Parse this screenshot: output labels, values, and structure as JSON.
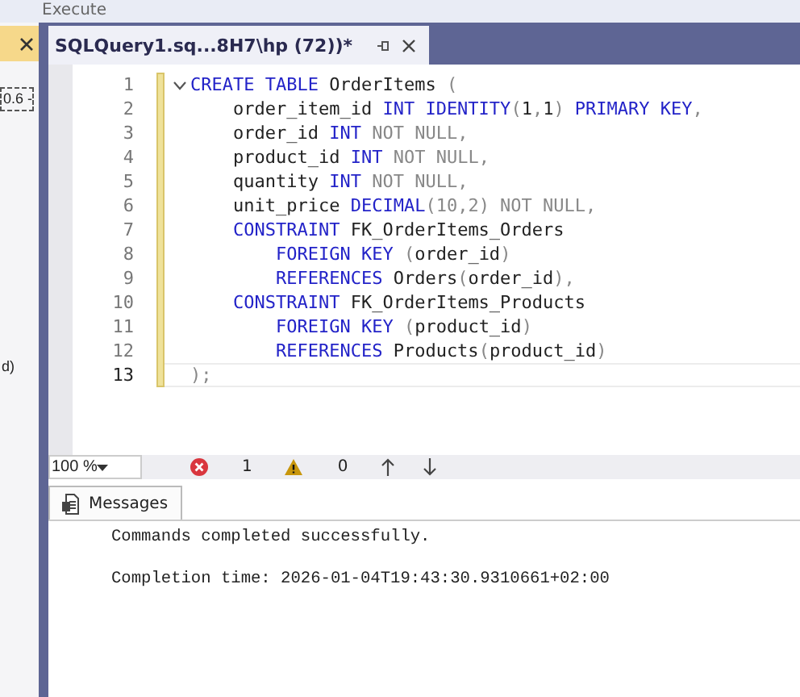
{
  "toolbar": {
    "execute_label": "Execute"
  },
  "left_panel": {
    "items": [
      {
        "label": "0.6 -",
        "selected": true
      },
      {
        "label": "d)",
        "selected": false
      }
    ]
  },
  "document_tab": {
    "title": "SQLQuery1.sq...8H7\\hp (72))*",
    "selected": true
  },
  "editor": {
    "lines": [
      {
        "number": "1",
        "current": false,
        "expanded": true,
        "tokens": [
          {
            "kind": "keyword",
            "text": "CREATE TABLE"
          },
          {
            "kind": "plain",
            "text": " OrderItems "
          },
          {
            "kind": "punct",
            "text": "("
          }
        ],
        "children": [
          {
            "number": "2",
            "current": false,
            "tokens": [
              {
                "kind": "plain",
                "text": "order_item_id "
              },
              {
                "kind": "keyword",
                "text": "INT IDENTITY"
              },
              {
                "kind": "punct",
                "text": "("
              },
              {
                "kind": "plain",
                "text": "1"
              },
              {
                "kind": "punct",
                "text": ","
              },
              {
                "kind": "plain",
                "text": "1"
              },
              {
                "kind": "punct",
                "text": ")"
              },
              {
                "kind": "keyword",
                "text": " PRIMARY KEY"
              },
              {
                "kind": "punct",
                "text": ","
              }
            ]
          },
          {
            "number": "3",
            "current": false,
            "tokens": [
              {
                "kind": "plain",
                "text": "order_id "
              },
              {
                "kind": "keyword",
                "text": "INT"
              },
              {
                "kind": "punct",
                "text": " NOT NULL,"
              }
            ]
          },
          {
            "number": "4",
            "current": false,
            "tokens": [
              {
                "kind": "plain",
                "text": "product_id "
              },
              {
                "kind": "keyword",
                "text": "INT"
              },
              {
                "kind": "punct",
                "text": " NOT NULL,"
              }
            ]
          },
          {
            "number": "5",
            "current": false,
            "tokens": [
              {
                "kind": "plain",
                "text": "quantity "
              },
              {
                "kind": "keyword",
                "text": "INT"
              },
              {
                "kind": "punct",
                "text": " NOT NULL,"
              }
            ]
          },
          {
            "number": "6",
            "current": false,
            "tokens": [
              {
                "kind": "plain",
                "text": "unit_price "
              },
              {
                "kind": "keyword",
                "text": "DECIMAL"
              },
              {
                "kind": "punct",
                "text": "(10,2) NOT NULL,"
              }
            ]
          },
          {
            "number": "7",
            "current": false,
            "tokens": [
              {
                "kind": "keyword",
                "text": "CONSTRAINT"
              },
              {
                "kind": "plain",
                "text": " FK_OrderItems_Orders"
              }
            ],
            "children": [
              {
                "number": "8",
                "current": false,
                "tokens": [
                  {
                    "kind": "keyword",
                    "text": "FOREIGN KEY"
                  },
                  {
                    "kind": "punct",
                    "text": " ("
                  },
                  {
                    "kind": "plain",
                    "text": "order_id"
                  },
                  {
                    "kind": "punct",
                    "text": ")"
                  }
                ]
              },
              {
                "number": "9",
                "current": false,
                "tokens": [
                  {
                    "kind": "keyword",
                    "text": "REFERENCES"
                  },
                  {
                    "kind": "plain",
                    "text": " Orders"
                  },
                  {
                    "kind": "punct",
                    "text": "("
                  },
                  {
                    "kind": "plain",
                    "text": "order_id"
                  },
                  {
                    "kind": "punct",
                    "text": "),"
                  }
                ]
              }
            ]
          },
          {
            "number": "10",
            "current": false,
            "tokens": [
              {
                "kind": "keyword",
                "text": "CONSTRAINT"
              },
              {
                "kind": "plain",
                "text": " FK_OrderItems_Products"
              }
            ],
            "children": [
              {
                "number": "11",
                "current": false,
                "tokens": [
                  {
                    "kind": "keyword",
                    "text": "FOREIGN KEY"
                  },
                  {
                    "kind": "punct",
                    "text": " ("
                  },
                  {
                    "kind": "plain",
                    "text": "product_id"
                  },
                  {
                    "kind": "punct",
                    "text": ")"
                  }
                ]
              },
              {
                "number": "12",
                "current": false,
                "tokens": [
                  {
                    "kind": "keyword",
                    "text": "REFERENCES"
                  },
                  {
                    "kind": "plain",
                    "text": " Products"
                  },
                  {
                    "kind": "punct",
                    "text": "("
                  },
                  {
                    "kind": "plain",
                    "text": "product_id"
                  },
                  {
                    "kind": "punct",
                    "text": ")"
                  }
                ]
              }
            ]
          }
        ]
      },
      {
        "number": "13",
        "current": true,
        "tokens": [
          {
            "kind": "punct",
            "text": ");"
          }
        ]
      }
    ]
  },
  "status_bar": {
    "zoom": "100 %",
    "errors": "1",
    "warnings": "0"
  },
  "results": {
    "tabs": [
      {
        "label": "Messages",
        "selected": true
      }
    ],
    "messages": [
      "Commands completed successfully.",
      "Completion time: 2026-01-04T19:43:30.9310661+02:00"
    ]
  }
}
